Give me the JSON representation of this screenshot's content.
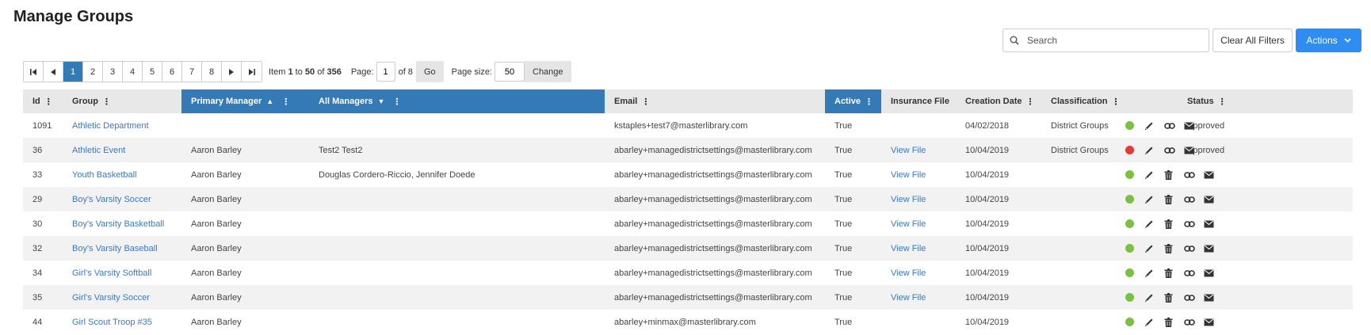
{
  "page": {
    "title": "Manage Groups"
  },
  "toolbar": {
    "search_placeholder": "Search",
    "clear_label": "Clear All Filters",
    "actions_label": "Actions"
  },
  "pager": {
    "pages": [
      "1",
      "2",
      "3",
      "4",
      "5",
      "6",
      "7",
      "8"
    ],
    "current_page": "1",
    "item_label": "Item",
    "range_start": "1",
    "to_label": "to",
    "range_end": "50",
    "of_label": "of",
    "total": "356",
    "page_label": "Page:",
    "page_value": "1",
    "of_pages": "of 8",
    "go_label": "Go",
    "page_size_label": "Page size:",
    "page_size_value": "50",
    "change_label": "Change"
  },
  "table": {
    "headers": {
      "id": "Id",
      "group": "Group",
      "primary_manager": "Primary Manager",
      "all_managers": "All Managers",
      "email": "Email",
      "active": "Active",
      "insurance_file": "Insurance File",
      "creation_date": "Creation Date",
      "classification": "Classification",
      "status": "Status"
    },
    "rows": [
      {
        "id": "1091",
        "group": "Athletic Department",
        "primary_manager": "",
        "all_managers": "",
        "email": "kstaples+test7@masterlibrary.com",
        "active": "True",
        "insurance_file": "",
        "creation_date": "04/02/2018",
        "classification": "District Groups",
        "status": "Approved",
        "status_color": "#7ac143",
        "actions": [
          "edit-icon",
          "link-icon",
          "mail-icon"
        ]
      },
      {
        "id": "36",
        "group": "Athletic Event",
        "primary_manager": "Aaron Barley",
        "all_managers": "Test2 Test2",
        "email": "abarley+managedistrictsettings@masterlibrary.com",
        "active": "True",
        "insurance_file": "View File",
        "creation_date": "10/04/2019",
        "classification": "District Groups",
        "status": "Approved",
        "status_color": "#e53935",
        "actions": [
          "edit-icon",
          "link-icon",
          "mail-icon"
        ]
      },
      {
        "id": "33",
        "group": "Youth Basketball",
        "primary_manager": "Aaron Barley",
        "all_managers": "Douglas Cordero-Riccio, Jennifer Doede",
        "email": "abarley+managedistrictsettings@masterlibrary.com",
        "active": "True",
        "insurance_file": "View File",
        "creation_date": "10/04/2019",
        "classification": "",
        "status": "",
        "status_color": "#7ac143",
        "actions": [
          "edit-icon",
          "trash-icon",
          "link-icon",
          "mail-icon"
        ]
      },
      {
        "id": "29",
        "group": "Boy's Varsity Soccer",
        "primary_manager": "Aaron Barley",
        "all_managers": "",
        "email": "abarley+managedistrictsettings@masterlibrary.com",
        "active": "True",
        "insurance_file": "View File",
        "creation_date": "10/04/2019",
        "classification": "",
        "status": "",
        "status_color": "#7ac143",
        "actions": [
          "edit-icon",
          "trash-icon",
          "link-icon",
          "mail-icon"
        ]
      },
      {
        "id": "30",
        "group": "Boy's Varsity Basketball",
        "primary_manager": "Aaron Barley",
        "all_managers": "",
        "email": "abarley+managedistrictsettings@masterlibrary.com",
        "active": "True",
        "insurance_file": "View File",
        "creation_date": "10/04/2019",
        "classification": "",
        "status": "",
        "status_color": "#7ac143",
        "actions": [
          "edit-icon",
          "trash-icon",
          "link-icon",
          "mail-icon"
        ]
      },
      {
        "id": "32",
        "group": "Boy's Varsity Baseball",
        "primary_manager": "Aaron Barley",
        "all_managers": "",
        "email": "abarley+managedistrictsettings@masterlibrary.com",
        "active": "True",
        "insurance_file": "View File",
        "creation_date": "10/04/2019",
        "classification": "",
        "status": "",
        "status_color": "#7ac143",
        "actions": [
          "edit-icon",
          "trash-icon",
          "link-icon",
          "mail-icon"
        ]
      },
      {
        "id": "34",
        "group": "Girl's Varsity Softball",
        "primary_manager": "Aaron Barley",
        "all_managers": "",
        "email": "abarley+managedistrictsettings@masterlibrary.com",
        "active": "True",
        "insurance_file": "View File",
        "creation_date": "10/04/2019",
        "classification": "",
        "status": "",
        "status_color": "#7ac143",
        "actions": [
          "edit-icon",
          "trash-icon",
          "link-icon",
          "mail-icon"
        ]
      },
      {
        "id": "35",
        "group": "Girl's Varsity Soccer",
        "primary_manager": "Aaron Barley",
        "all_managers": "",
        "email": "abarley+managedistrictsettings@masterlibrary.com",
        "active": "True",
        "insurance_file": "View File",
        "creation_date": "10/04/2019",
        "classification": "",
        "status": "",
        "status_color": "#7ac143",
        "actions": [
          "edit-icon",
          "trash-icon",
          "link-icon",
          "mail-icon"
        ]
      },
      {
        "id": "44",
        "group": "Girl Scout Troop #35",
        "primary_manager": "Aaron Barley",
        "all_managers": "",
        "email": "abarley+minmax@masterlibrary.com",
        "active": "True",
        "insurance_file": "",
        "creation_date": "10/04/2019",
        "classification": "",
        "status": "",
        "status_color": "#7ac143",
        "actions": [
          "edit-icon",
          "trash-icon",
          "link-icon",
          "mail-icon"
        ]
      }
    ]
  },
  "colors": {
    "accent": "#337ab7",
    "actions_button": "#2f8cf0",
    "link": "#3a78c9",
    "status_green": "#7ac143",
    "status_red": "#e53935"
  }
}
